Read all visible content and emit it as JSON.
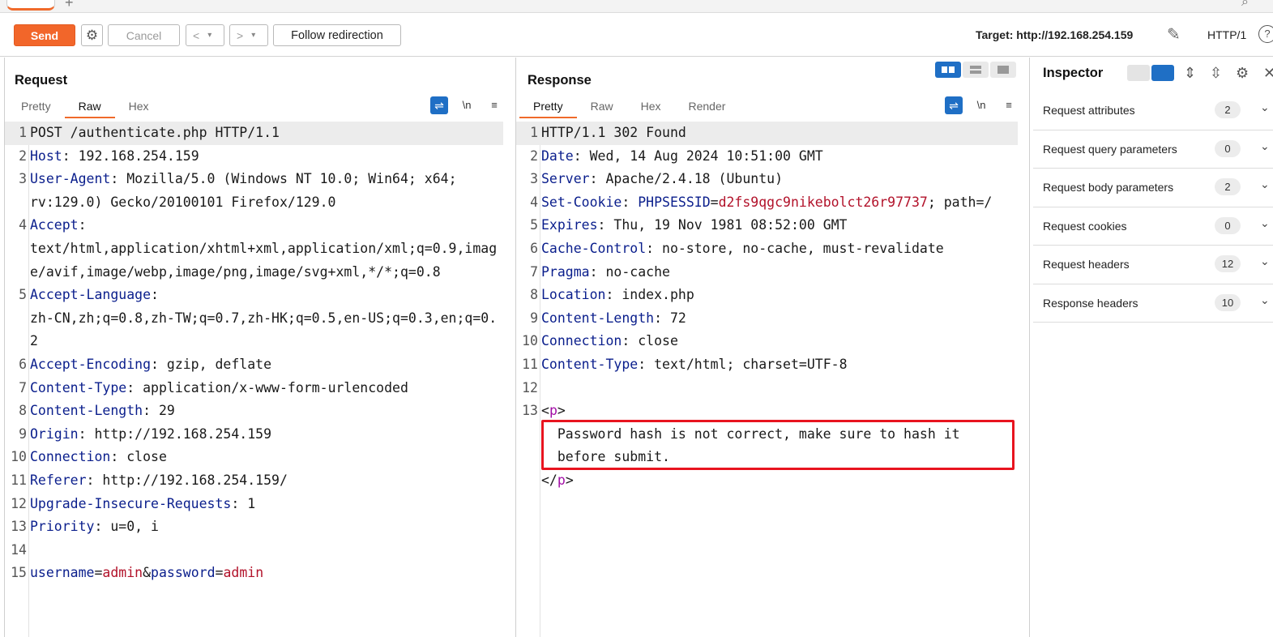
{
  "toolbar": {
    "send_label": "Send",
    "cancel_label": "Cancel",
    "back_label": "<",
    "forward_label": ">",
    "follow_label": "Follow redirection",
    "target_label": "Target: http://192.168.254.159",
    "protocol_label": "HTTP/1",
    "help_label": "?"
  },
  "request": {
    "title": "Request",
    "tabs": [
      "Pretty",
      "Raw",
      "Hex"
    ],
    "active_tab": "Raw",
    "tools": {
      "newline": "\\n",
      "menu": "≡"
    }
  },
  "response": {
    "title": "Response",
    "tabs": [
      "Pretty",
      "Raw",
      "Hex",
      "Render"
    ],
    "active_tab": "Pretty",
    "tools": {
      "newline": "\\n",
      "menu": "≡"
    }
  },
  "request_lines": [
    {
      "n": "1",
      "parts": [
        [
          "plain",
          "POST /authenticate.php HTTP/1.1"
        ]
      ],
      "hl": true
    },
    {
      "n": "2",
      "parts": [
        [
          "key",
          "Host"
        ],
        [
          "plain",
          ": 192.168.254.159"
        ]
      ]
    },
    {
      "n": "3",
      "parts": [
        [
          "key",
          "User-Agent"
        ],
        [
          "plain",
          ": Mozilla/5.0 (Windows NT 10.0; Win64; x64;"
        ]
      ]
    },
    {
      "n": "",
      "parts": [
        [
          "plain",
          "rv:129.0) Gecko/20100101 Firefox/129.0"
        ]
      ]
    },
    {
      "n": "4",
      "parts": [
        [
          "key",
          "Accept"
        ],
        [
          "plain",
          ":"
        ]
      ]
    },
    {
      "n": "",
      "parts": [
        [
          "plain",
          "text/html,application/xhtml+xml,application/xml;q=0.9,imag"
        ]
      ]
    },
    {
      "n": "",
      "parts": [
        [
          "plain",
          "e/avif,image/webp,image/png,image/svg+xml,*/*;q=0.8"
        ]
      ]
    },
    {
      "n": "5",
      "parts": [
        [
          "key",
          "Accept-Language"
        ],
        [
          "plain",
          ":"
        ]
      ]
    },
    {
      "n": "",
      "parts": [
        [
          "plain",
          "zh-CN,zh;q=0.8,zh-TW;q=0.7,zh-HK;q=0.5,en-US;q=0.3,en;q=0."
        ]
      ]
    },
    {
      "n": "",
      "parts": [
        [
          "plain",
          "2"
        ]
      ]
    },
    {
      "n": "6",
      "parts": [
        [
          "key",
          "Accept-Encoding"
        ],
        [
          "plain",
          ": gzip, deflate"
        ]
      ]
    },
    {
      "n": "7",
      "parts": [
        [
          "key",
          "Content-Type"
        ],
        [
          "plain",
          ": application/x-www-form-urlencoded"
        ]
      ]
    },
    {
      "n": "8",
      "parts": [
        [
          "key",
          "Content-Length"
        ],
        [
          "plain",
          ": 29"
        ]
      ]
    },
    {
      "n": "9",
      "parts": [
        [
          "key",
          "Origin"
        ],
        [
          "plain",
          ": http://192.168.254.159"
        ]
      ]
    },
    {
      "n": "10",
      "parts": [
        [
          "key",
          "Connection"
        ],
        [
          "plain",
          ": close"
        ]
      ]
    },
    {
      "n": "11",
      "parts": [
        [
          "key",
          "Referer"
        ],
        [
          "plain",
          ": http://192.168.254.159/"
        ]
      ]
    },
    {
      "n": "12",
      "parts": [
        [
          "key",
          "Upgrade-Insecure-Requests"
        ],
        [
          "plain",
          ": 1"
        ]
      ]
    },
    {
      "n": "13",
      "parts": [
        [
          "key",
          "Priority"
        ],
        [
          "plain",
          ": u=0, i"
        ]
      ]
    },
    {
      "n": "14",
      "parts": [
        [
          "plain",
          ""
        ]
      ]
    },
    {
      "n": "15",
      "parts": [
        [
          "key",
          "username"
        ],
        [
          "plain",
          "="
        ],
        [
          "red",
          "admin"
        ],
        [
          "plain",
          "&"
        ],
        [
          "key",
          "password"
        ],
        [
          "plain",
          "="
        ],
        [
          "red",
          "admin"
        ]
      ]
    }
  ],
  "response_lines": [
    {
      "n": "1",
      "parts": [
        [
          "plain",
          "HTTP/1.1 302 Found"
        ]
      ],
      "hl": true
    },
    {
      "n": "2",
      "parts": [
        [
          "key",
          "Date"
        ],
        [
          "plain",
          ": Wed, 14 Aug 2024 10:51:00 GMT"
        ]
      ]
    },
    {
      "n": "3",
      "parts": [
        [
          "key",
          "Server"
        ],
        [
          "plain",
          ": Apache/2.4.18 (Ubuntu)"
        ]
      ]
    },
    {
      "n": "4",
      "parts": [
        [
          "key",
          "Set-Cookie"
        ],
        [
          "plain",
          ": "
        ],
        [
          "key",
          "PHPSESSID"
        ],
        [
          "plain",
          "="
        ],
        [
          "red",
          "d2fs9qgc9nikebolct26r97737"
        ],
        [
          "plain",
          "; path=/"
        ]
      ]
    },
    {
      "n": "5",
      "parts": [
        [
          "key",
          "Expires"
        ],
        [
          "plain",
          ": Thu, 19 Nov 1981 08:52:00 GMT"
        ]
      ]
    },
    {
      "n": "6",
      "parts": [
        [
          "key",
          "Cache-Control"
        ],
        [
          "plain",
          ": no-store, no-cache, must-revalidate"
        ]
      ]
    },
    {
      "n": "7",
      "parts": [
        [
          "key",
          "Pragma"
        ],
        [
          "plain",
          ": no-cache"
        ]
      ]
    },
    {
      "n": "8",
      "parts": [
        [
          "key",
          "Location"
        ],
        [
          "plain",
          ": index.php"
        ]
      ]
    },
    {
      "n": "9",
      "parts": [
        [
          "key",
          "Content-Length"
        ],
        [
          "plain",
          ": 72"
        ]
      ]
    },
    {
      "n": "10",
      "parts": [
        [
          "key",
          "Connection"
        ],
        [
          "plain",
          ": close"
        ]
      ]
    },
    {
      "n": "11",
      "parts": [
        [
          "key",
          "Content-Type"
        ],
        [
          "plain",
          ": text/html; charset=UTF-8"
        ]
      ]
    },
    {
      "n": "12",
      "parts": [
        [
          "plain",
          ""
        ]
      ]
    },
    {
      "n": "13",
      "parts": [
        [
          "plain",
          "<"
        ],
        [
          "tag",
          "p"
        ],
        [
          "plain",
          ">"
        ]
      ]
    },
    {
      "n": "",
      "parts": [
        [
          "plain",
          "  Password hash is not correct, make sure to hash it"
        ]
      ]
    },
    {
      "n": "",
      "parts": [
        [
          "plain",
          "  before submit."
        ]
      ]
    },
    {
      "n": "",
      "parts": [
        [
          "plain",
          "</"
        ],
        [
          "tag",
          "p"
        ],
        [
          "plain",
          ">"
        ]
      ]
    }
  ],
  "inspector": {
    "title": "Inspector",
    "rows": [
      {
        "label": "Request attributes",
        "count": "2"
      },
      {
        "label": "Request query parameters",
        "count": "0"
      },
      {
        "label": "Request body parameters",
        "count": "2"
      },
      {
        "label": "Request cookies",
        "count": "0"
      },
      {
        "label": "Request headers",
        "count": "12"
      },
      {
        "label": "Response headers",
        "count": "10"
      }
    ]
  },
  "colors": {
    "accent": "#f06a2b",
    "header_key": "#0a1e8c",
    "value_red": "#b2122a",
    "tag_purple": "#a20ea6",
    "highlight_box": "#e8141f",
    "toggle_blue": "#1f6fc5"
  }
}
